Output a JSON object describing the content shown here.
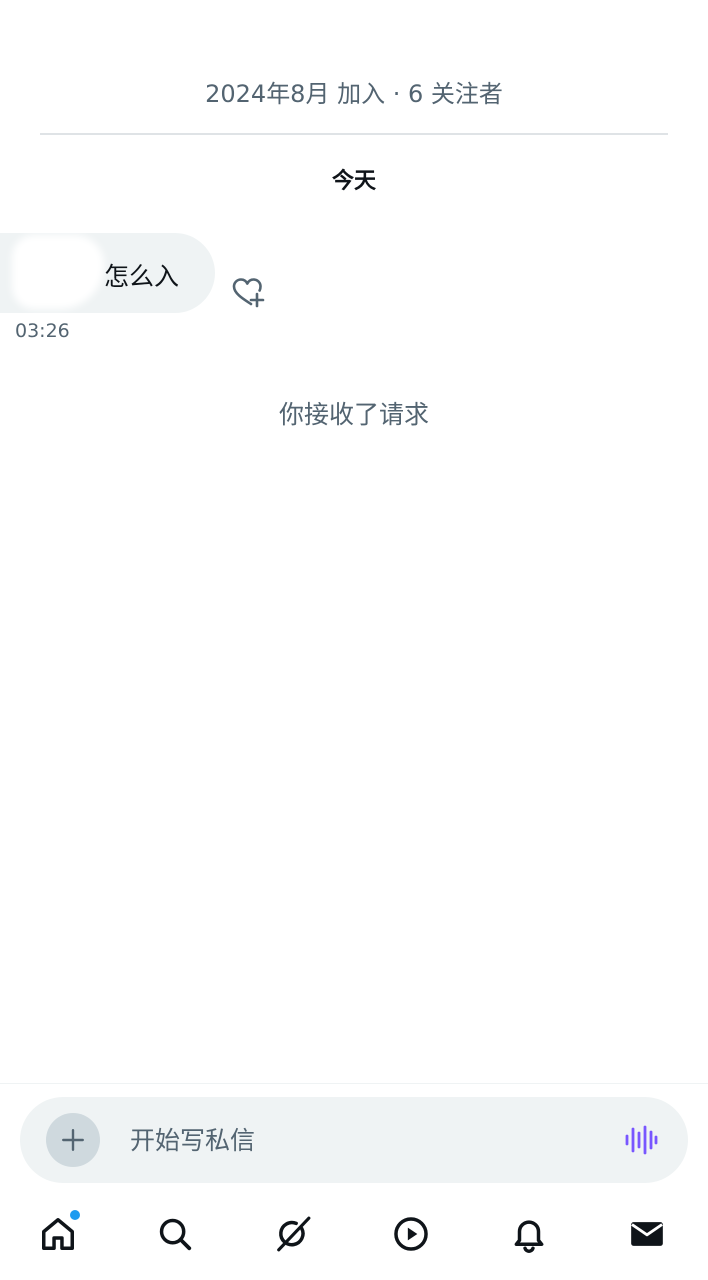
{
  "profile": {
    "meta": "2024年8月 加入 · 6 关注者"
  },
  "conversation": {
    "day_label": "今天",
    "messages": [
      {
        "text": "怎么入",
        "time": "03:26"
      }
    ],
    "system_notice": "你接收了请求"
  },
  "composer": {
    "placeholder": "开始写私信"
  },
  "tabbar": {
    "items": [
      {
        "icon": "home-icon",
        "has_badge": true
      },
      {
        "icon": "search-icon"
      },
      {
        "icon": "grok-icon"
      },
      {
        "icon": "play-icon"
      },
      {
        "icon": "bell-icon"
      },
      {
        "icon": "mail-icon"
      }
    ]
  },
  "colors": {
    "accent": "#1d9bf0",
    "voice": "#7856ff",
    "muted": "#536471"
  }
}
